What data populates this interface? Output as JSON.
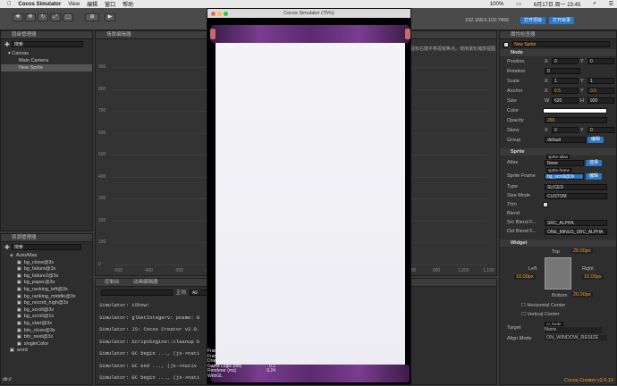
{
  "menubar": {
    "apple": "",
    "app": "Cocos Simulator",
    "view": "View",
    "edit": "编辑",
    "window": "窗口",
    "help": "帮助",
    "status": "100%",
    "date": "6月17日 周一 23:45"
  },
  "toolbar": {
    "ip": "192.168.0.102:7456",
    "wifi": "▾",
    "open_project": "打开项目",
    "open_editor": "打开目录"
  },
  "hierarchy": {
    "title": "层级管理器",
    "search_placeholder": "搜索",
    "items": [
      "Canvas",
      "Main Camera",
      "New Sprite"
    ]
  },
  "scene": {
    "title": "场景编辑器",
    "hint": "鼠标右键平移视窗焦点。使用滚轮缩放视图",
    "y_ticks": [
      "900",
      "800",
      "700",
      "600",
      "500",
      "400",
      "300",
      "200",
      "100",
      "0"
    ],
    "x_ticks": [
      "-500",
      "-400",
      "-300",
      "-200",
      "-100",
      "0",
      "800",
      "900",
      "1,000",
      "1,100",
      "1,200"
    ]
  },
  "assets": {
    "title": "资源管理器",
    "search_placeholder": "搜索",
    "items": [
      "AutoAtlas",
      "bg_close@3x",
      "bg_failure@3x",
      "bg_failure2@3x",
      "bg_paper@3x",
      "bg_ranking_left@3x",
      "bg_ranking_middle@3x",
      "bg_record_high@3x",
      "bg_scroll@3x",
      "bg_scroll@1x",
      "bg_start@3x",
      "btn_close@3x",
      "btn_next@3x",
      "singleColor",
      "word"
    ],
    "footer": "db://"
  },
  "console": {
    "tab1": "控制台",
    "tab2": "动画编辑器",
    "filter_label": "正则",
    "mode": "All",
    "lines": [
      "Simulator: iShow!",
      "Simulator: glGetIntegerv: pname: 0",
      "Simulator: JS: Cocos Creator v2.0.",
      "Simulator: ScriptEngine::cleanup b",
      "Simulator: GC begin ..., (js->nati",
      "Simulator: GC end ..., (js->nativ",
      "Simulator: GC begin ..., (js->nati"
    ]
  },
  "simulator": {
    "title": "Cocos Simulator (75%)",
    "stats": [
      [
        "Framerate (FPS)",
        "59"
      ],
      [
        "Frame time (ms)",
        "0.51"
      ],
      [
        "Draw call",
        "2"
      ],
      [
        "Game Logic (ms)",
        "0.1"
      ],
      [
        "Renderer (ms)",
        "0.24"
      ],
      [
        "WebGL",
        ""
      ]
    ]
  },
  "inspector": {
    "title": "属性检查器",
    "node_name": "New Sprite",
    "node": {
      "header": "Node",
      "position": {
        "label": "Position",
        "x": "0",
        "y": "0"
      },
      "rotation": {
        "label": "Rotation",
        "v": "0"
      },
      "scale": {
        "label": "Scale",
        "x": "1",
        "y": "1"
      },
      "anchor": {
        "label": "Anchor",
        "x": "0.5",
        "y": "0.5"
      },
      "size": {
        "label": "Size",
        "w": "620",
        "h": "920"
      },
      "color": {
        "label": "Color"
      },
      "opacity": {
        "label": "Opacity",
        "v": "255"
      },
      "skew": {
        "label": "Skew",
        "x": "0",
        "y": "0"
      },
      "group": {
        "label": "Group",
        "v": "default",
        "btn": "编辑"
      }
    },
    "sprite": {
      "header": "Sprite",
      "atlas": {
        "label": "Atlas",
        "tag": "sprite-atlas",
        "v": "None",
        "btn": "选择"
      },
      "frame": {
        "label": "Sprite Frame",
        "tag": "sprite-frame",
        "v": "bg_scroll@3x",
        "btn": "编辑"
      },
      "type": {
        "label": "Type",
        "v": "SLICED"
      },
      "sizemode": {
        "label": "Size Mode",
        "v": "CUSTOM"
      },
      "trim": {
        "label": "Trim"
      },
      "blend": {
        "label": "Blend"
      },
      "src": {
        "label": "Src Blend F...",
        "v": "SRC_ALPHA"
      },
      "dst": {
        "label": "Dst Blend F...",
        "v": "ONE_MINUS_SRC_ALPHA"
      }
    },
    "widget": {
      "header": "Widget",
      "top": "Top",
      "top_v": "20.00px",
      "left": "Left",
      "left_v": "10.00px",
      "right": "Right",
      "right_v": "10.00px",
      "bottom": "Bottom",
      "bottom_v": "20.00px",
      "hcenter": "Horizontal Center",
      "vcenter": "Vertical Center",
      "target": {
        "label": "Target",
        "tag": "cc.Node",
        "v": "None"
      },
      "align": {
        "label": "Align Mode",
        "v": "ON_WINDOW_RESIZE"
      }
    },
    "footer": "Cocos Creator v2.0.10"
  }
}
